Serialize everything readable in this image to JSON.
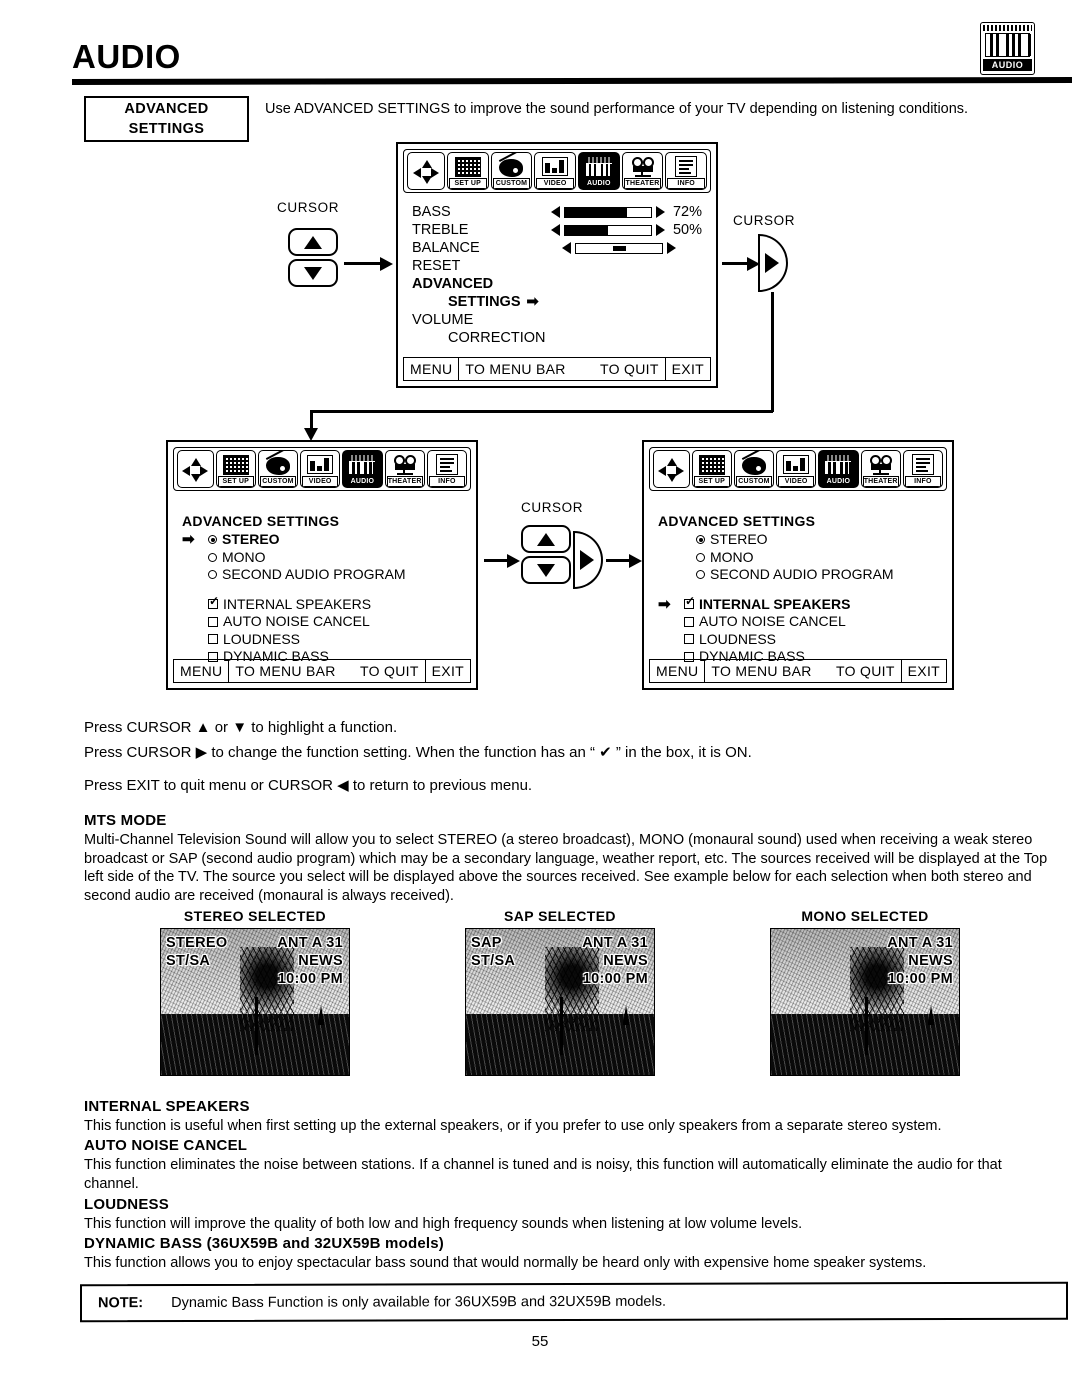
{
  "document": {
    "title": "AUDIO",
    "page_number": "55",
    "corner_icon": {
      "name": "audio-piano-icon",
      "label": "AUDIO"
    }
  },
  "callout": {
    "box_line1": "ADVANCED",
    "box_line2": "SETTINGS",
    "description": "Use ADVANCED SETTINGS to improve the sound performance of your TV depending on listening conditions."
  },
  "menu_bar": {
    "items": [
      {
        "icon": "nav-cross-icon",
        "label": "",
        "selected": false
      },
      {
        "icon": "setup-icon",
        "label": "SET UP",
        "selected": false
      },
      {
        "icon": "palette-icon",
        "label": "CUSTOM",
        "selected": false
      },
      {
        "icon": "video-icon",
        "label": "VIDEO",
        "selected": false
      },
      {
        "icon": "piano-icon",
        "label": "AUDIO",
        "selected": true
      },
      {
        "icon": "film-camera-icon",
        "label": "THEATER",
        "selected": false
      },
      {
        "icon": "document-icon",
        "label": "INFO",
        "selected": false
      }
    ]
  },
  "footer_bar": {
    "menu": "MENU",
    "to_menu_bar": "TO MENU BAR",
    "to_quit": "TO QUIT",
    "exit": "EXIT"
  },
  "panel_audio": {
    "rows": [
      {
        "label": "BASS",
        "type": "bar",
        "value": 72,
        "value_text": "72%"
      },
      {
        "label": "TREBLE",
        "type": "bar",
        "value": 50,
        "value_text": "50%"
      },
      {
        "label": "BALANCE",
        "type": "knob",
        "value": 50,
        "value_text": ""
      },
      {
        "label": "RESET",
        "type": "text",
        "value": null,
        "value_text": ""
      }
    ],
    "advanced_line1": "ADVANCED",
    "advanced_line2": "SETTINGS",
    "advanced_arrow": "➡",
    "volume_line1": "VOLUME",
    "volume_line2": "CORRECTION"
  },
  "panel_advanced_left": {
    "heading": "ADVANCED SETTINGS",
    "pointer_index": 0,
    "radios": [
      {
        "label": "STEREO",
        "selected": true
      },
      {
        "label": "MONO",
        "selected": false
      },
      {
        "label": "SECOND AUDIO PROGRAM",
        "selected": false
      }
    ],
    "checkboxes": [
      {
        "label": "INTERNAL SPEAKERS",
        "checked": true
      },
      {
        "label": "AUTO NOISE CANCEL",
        "checked": false
      },
      {
        "label": "LOUDNESS",
        "checked": false
      },
      {
        "label": "DYNAMIC BASS",
        "checked": false
      }
    ]
  },
  "panel_advanced_right": {
    "heading": "ADVANCED SETTINGS",
    "pointer_target": "INTERNAL SPEAKERS",
    "radios": [
      {
        "label": "STEREO",
        "selected": true
      },
      {
        "label": "MONO",
        "selected": false
      },
      {
        "label": "SECOND AUDIO PROGRAM",
        "selected": false
      }
    ],
    "checkboxes": [
      {
        "label": "INTERNAL SPEAKERS",
        "checked": true
      },
      {
        "label": "AUTO NOISE CANCEL",
        "checked": false
      },
      {
        "label": "LOUDNESS",
        "checked": false
      },
      {
        "label": "DYNAMIC BASS",
        "checked": false
      }
    ]
  },
  "cursor_controls": {
    "label": "CURSOR",
    "up_glyph": "▲",
    "down_glyph": "▼",
    "right_glyph": "▶"
  },
  "instructions": [
    "Press CURSOR ▲ or ▼ to highlight a function.",
    "Press CURSOR ▶ to change the function setting. When the function has an “ ✔ ” in the box, it is ON.",
    "Press EXIT to quit menu or CURSOR ◀ to return to previous menu."
  ],
  "sections": [
    {
      "heading": "MTS MODE",
      "body": "Multi-Channel Television Sound will allow you to select STEREO (a stereo broadcast), MONO (monaural sound) used when receiving a weak stereo broadcast or SAP (second audio program) which may be a secondary language, weather report, etc. The sources received will be displayed at the Top left side of the TV. The source you select will be displayed above the sources received. See example below for each selection when both stereo and second audio are received (monaural is always received)."
    },
    {
      "heading": "INTERNAL  SPEAKERS",
      "body": "This function is useful when first setting up the external speakers, or if you prefer to use only speakers from a separate stereo system."
    },
    {
      "heading": "AUTO NOISE CANCEL",
      "body": "This function eliminates the noise between stations. If a channel is tuned and is noisy, this function will automatically eliminate the audio for that channel."
    },
    {
      "heading": "LOUDNESS",
      "body": "This function will improve the quality of both low and high frequency sounds when listening at low volume levels."
    },
    {
      "heading": "DYNAMIC BASS (36UX59B and 32UX59B models)",
      "body": "This function allows you to enjoy spectacular bass sound that would normally be heard only with expensive home speaker systems."
    }
  ],
  "tv_examples": [
    {
      "caption": "STEREO SELECTED",
      "left_line1": "STEREO",
      "left_line2": "ST/SA",
      "right_line1": "ANT A 31",
      "right_line2": "NEWS",
      "right_line3": "10:00 PM"
    },
    {
      "caption": "SAP SELECTED",
      "left_line1": "SAP",
      "left_line2": "ST/SA",
      "right_line1": "ANT A 31",
      "right_line2": "NEWS",
      "right_line3": "10:00 PM"
    },
    {
      "caption": "MONO SELECTED",
      "left_line1": "",
      "left_line2": "",
      "right_line1": "ANT A 31",
      "right_line2": "NEWS",
      "right_line3": "10:00 PM"
    }
  ],
  "note": {
    "label": "NOTE:",
    "text": "Dynamic Bass Function is only available for 36UX59B and 32UX59B models."
  }
}
